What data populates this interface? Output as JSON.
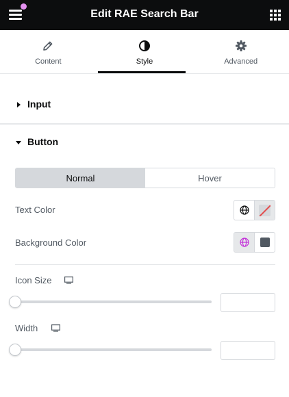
{
  "header": {
    "title": "Edit RAE Search Bar",
    "menu_icon": "hamburger-icon",
    "apps_icon": "grid-icon",
    "notification_color": "#e490ef"
  },
  "tabs": [
    {
      "label": "Content",
      "icon": "pencil-icon",
      "active": false
    },
    {
      "label": "Style",
      "icon": "half-circle-icon",
      "active": true
    },
    {
      "label": "Advanced",
      "icon": "gear-icon",
      "active": false
    }
  ],
  "sections": {
    "input": {
      "label": "Input",
      "expanded": false
    },
    "button": {
      "label": "Button",
      "expanded": true
    }
  },
  "state_switch": {
    "options": [
      "Normal",
      "Hover"
    ],
    "selected": "Normal"
  },
  "controls": {
    "text_color": {
      "label": "Text Color",
      "value": null
    },
    "background_color": {
      "label": "Background Color",
      "value": "#515962",
      "global_active_color": "#c32ed9"
    },
    "icon_size": {
      "label": "Icon Size",
      "device_icon": "desktop-icon",
      "value": "",
      "slider_position": 0
    },
    "width": {
      "label": "Width",
      "device_icon": "desktop-icon",
      "value": "",
      "slider_position": 0
    }
  },
  "colors": {
    "accent_dark": "#0c0d0e",
    "border": "#d5d8dc"
  }
}
